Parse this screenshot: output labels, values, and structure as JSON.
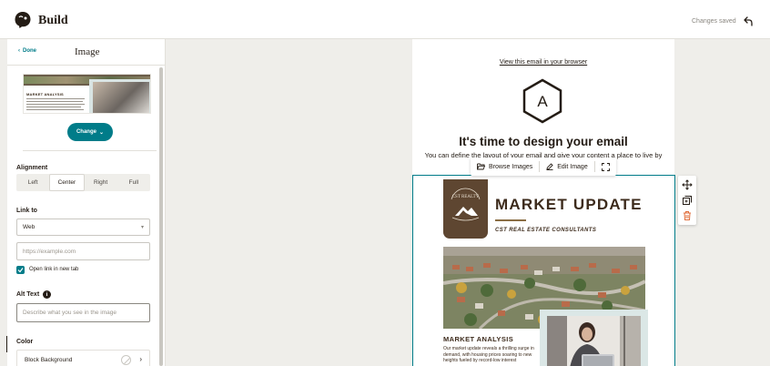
{
  "app": {
    "title": "Build",
    "status": "Changes saved"
  },
  "panel": {
    "done_label": "Done",
    "title": "Image",
    "change_label": "Change",
    "thumbnail_heading": "MARKET ANALYSIS",
    "alignment": {
      "label": "Alignment",
      "options": [
        "Left",
        "Center",
        "Right",
        "Full"
      ],
      "selected": "Center"
    },
    "link_to": {
      "label": "Link to",
      "selected": "Web",
      "url_placeholder": "https://example.com",
      "open_new_tab_label": "Open link in new tab",
      "open_new_tab_checked": true
    },
    "alt_text": {
      "label": "Alt Text",
      "placeholder": "Describe what you see in the image"
    },
    "color": {
      "label": "Color",
      "block_background_label": "Block Background"
    }
  },
  "email": {
    "view_link": "View this email in your browser",
    "logo_letter": "A",
    "heading": "It's time to design your email",
    "subtext": "You can define the layout of your email and give your content a place to live by"
  },
  "image_toolbar": {
    "browse_label": "Browse Images",
    "edit_label": "Edit Image"
  },
  "market_image": {
    "seal_text": "CST REALTY",
    "title": "MARKET UPDATE",
    "subtitle": "CST REAL ESTATE CONSULTANTS",
    "analysis_heading": "MARKET ANALYSIS",
    "body": "Our market update reveals a thrilling surge in demand, with housing prices soaring to new heights fueled by record-low interest"
  },
  "colors": {
    "accent": "#007c89",
    "brand_brown": "#3d2b1c",
    "delete_red": "#e06c3a"
  },
  "icons": {
    "logo": "mailchimp-logo-icon",
    "undo": "undo-icon",
    "done": "chevron-left-icon",
    "change": "chevron-down-icon",
    "browse": "folder-open-icon",
    "edit": "pencil-icon",
    "resize": "expand-icon",
    "move": "move-icon",
    "duplicate": "duplicate-icon",
    "delete": "trash-icon",
    "info": "info-icon"
  }
}
